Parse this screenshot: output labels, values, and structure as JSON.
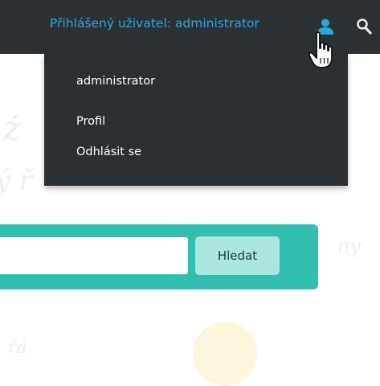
{
  "header": {
    "user_label": "Přihlášený uživatel: administrator",
    "user_icon": "user-icon",
    "search_icon": "search-icon"
  },
  "dropdown": {
    "username": "administrator",
    "items": [
      {
        "label": "Profil"
      },
      {
        "label": "Odhlásit se"
      }
    ]
  },
  "search": {
    "input_value": "",
    "button_label": "Hledat"
  },
  "colors": {
    "topbar": "#2b3034",
    "link": "#2aa8d6",
    "panel": "#33bfb0",
    "button": "#a9e6de"
  }
}
